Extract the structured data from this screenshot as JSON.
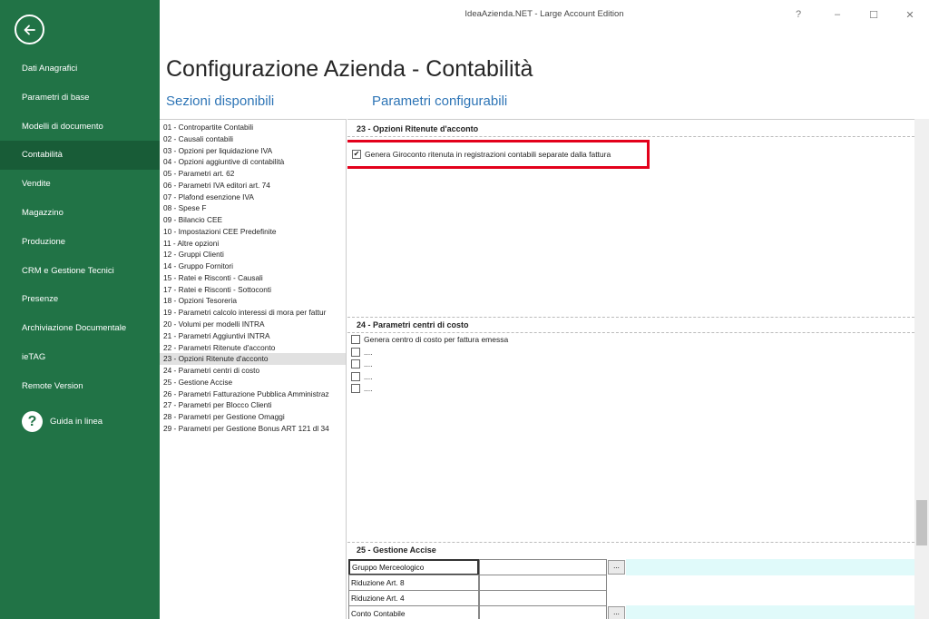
{
  "window": {
    "title": "IdeaAzienda.NET - Large Account Edition",
    "help": "?",
    "minimize": "–",
    "maximize": "☐",
    "close": "✕"
  },
  "sidebar": {
    "items": [
      {
        "label": "Dati Anagrafici"
      },
      {
        "label": "Parametri di base"
      },
      {
        "label": "Modelli di documento"
      },
      {
        "label": "Contabilità",
        "active": true
      },
      {
        "label": "Vendite"
      },
      {
        "label": "Magazzino"
      },
      {
        "label": "Produzione"
      },
      {
        "label": "CRM e Gestione Tecnici"
      },
      {
        "label": "Presenze"
      },
      {
        "label": "Archiviazione Documentale"
      },
      {
        "label": "ieTAG"
      },
      {
        "label": "Remote Version"
      }
    ],
    "help_icon": "?",
    "help_label": "Guida in linea"
  },
  "page": {
    "title": "Configurazione Azienda - Contabilità",
    "sections_heading": "Sezioni disponibili",
    "params_heading": "Parametri configurabili"
  },
  "sections": [
    "01 - Contropartite Contabili",
    "02 - Causali contabili",
    "03 - Opzioni per liquidazione IVA",
    "04 - Opzioni aggiuntive di contabilità",
    "05 - Parametri art. 62",
    "06 - Parametri IVA editori art. 74",
    "07 - Plafond esenzione IVA",
    "08 - Spese F",
    "09 - Bilancio CEE",
    "10 - Impostazioni CEE Predefinite",
    "11 - Altre opzioni",
    "12 - Gruppi Clienti",
    "14 - Gruppo Fornitori",
    "15 - Ratei e Risconti - Causali",
    "17 - Ratei e Risconti - Sottoconti",
    "18 - Opzioni Tesoreria",
    "19 - Parametri calcolo interessi di mora per fattur",
    "20 - Volumi per modelli INTRA",
    "21 - Parametri Aggiuntivi INTRA",
    "22 - Parametri Ritenute d'acconto",
    "23 - Opzioni Ritenute d'acconto",
    "24 - Parametri centri di costo",
    "25 - Gestione Accise",
    "26 - Parametri Fatturazione Pubblica Amministraz",
    "27 - Parametri per Blocco Clienti",
    "28 - Parametri per Gestione Omaggi",
    "29 - Parametri per Gestione Bonus ART 121 dl 34"
  ],
  "selected_section": "23 - Opzioni Ritenute d'acconto",
  "params": {
    "g23": {
      "title": "23 - Opzioni Ritenute d'acconto",
      "checkbox": {
        "label": "Genera Giroconto ritenuta in registrazioni contabili separate dalla fattura",
        "checked": true,
        "mark": "✔"
      }
    },
    "g24": {
      "title": "24 - Parametri centri di costo",
      "checkboxes": [
        {
          "label": "Genera centro di costo per fattura emessa"
        },
        {
          "label": "...."
        },
        {
          "label": "...."
        },
        {
          "label": "...."
        },
        {
          "label": "...."
        }
      ]
    },
    "g25": {
      "title": "25 - Gestione Accise",
      "rows": [
        {
          "label": "Gruppo Merceologico",
          "button": "...",
          "focus": true
        },
        {
          "label": "Riduzione Art. 8"
        },
        {
          "label": "Riduzione Art. 4"
        },
        {
          "label": "Conto Contabile",
          "button": "..."
        }
      ]
    }
  },
  "colors": {
    "sidebar": "#217346",
    "sidebar_active": "#185c37",
    "heading_blue": "#2e75b6",
    "highlight_red": "#e3001b"
  }
}
